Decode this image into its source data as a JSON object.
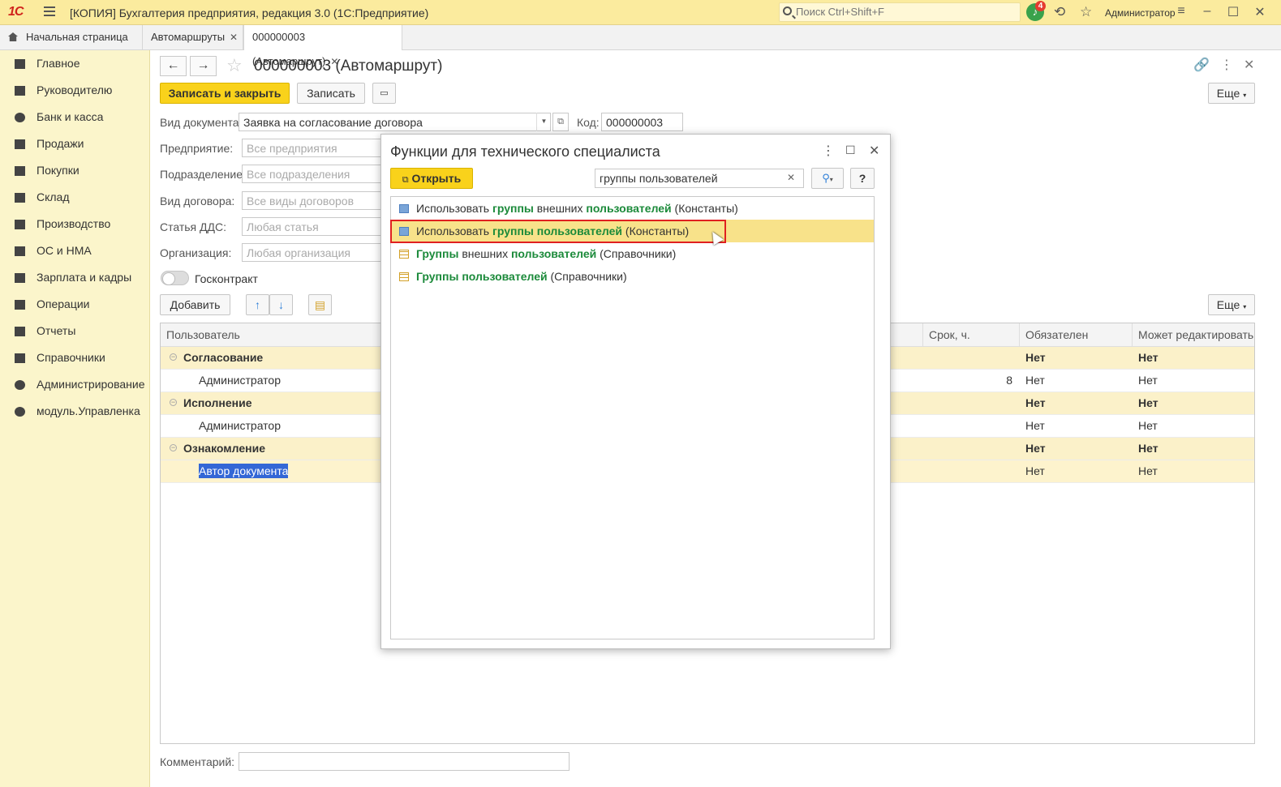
{
  "titlebar": {
    "logo": "1С",
    "title": "[КОПИЯ] Бухгалтерия предприятия, редакция 3.0  (1С:Предприятие)",
    "search_placeholder": "Поиск Ctrl+Shift+F",
    "notifications_count": "4",
    "user": "Администратор"
  },
  "tabs": [
    {
      "label": "Начальная страница"
    },
    {
      "label": "Автомаршруты"
    },
    {
      "label": "000000003 (Автомаршрут)"
    }
  ],
  "sidebar": {
    "items": [
      {
        "label": "Главное"
      },
      {
        "label": "Руководителю"
      },
      {
        "label": "Банк и касса"
      },
      {
        "label": "Продажи"
      },
      {
        "label": "Покупки"
      },
      {
        "label": "Склад"
      },
      {
        "label": "Производство"
      },
      {
        "label": "ОС и НМА"
      },
      {
        "label": "Зарплата и кадры"
      },
      {
        "label": "Операции"
      },
      {
        "label": "Отчеты"
      },
      {
        "label": "Справочники"
      },
      {
        "label": "Администрирование"
      },
      {
        "label": "модуль.Управленка"
      }
    ]
  },
  "form": {
    "title": "000000003 (Автомаршрут)",
    "save_close": "Записать и закрыть",
    "save": "Записать",
    "more": "Еще",
    "doc_type_label": "Вид документа:",
    "doc_type_value": "Заявка на согласование договора",
    "code_label": "Код:",
    "code_value": "000000003",
    "enterprise_label": "Предприятие:",
    "enterprise_ph": "Все предприятия",
    "division_label": "Подразделение:",
    "division_ph": "Все подразделения",
    "contract_type_label": "Вид договора:",
    "contract_type_ph": "Все виды договоров",
    "dds_label": "Статья ДДС:",
    "dds_ph": "Любая статья",
    "org_label": "Организация:",
    "org_ph": "Любая организация",
    "goscontract_label": "Госконтракт",
    "add": "Добавить",
    "more2": "Еще",
    "comment_label": "Комментарий:"
  },
  "grid": {
    "headers": [
      "Пользователь",
      "Срок, ч.",
      "Обязателен",
      "Может редактировать"
    ],
    "rows": [
      {
        "user": "Согласование",
        "term": "",
        "required": "Нет",
        "editable": "Нет",
        "group": true
      },
      {
        "user": "Администратор",
        "term": "8",
        "required": "Нет",
        "editable": "Нет",
        "group": false
      },
      {
        "user": "Исполнение",
        "term": "",
        "required": "Нет",
        "editable": "Нет",
        "group": true
      },
      {
        "user": "Администратор",
        "term": "",
        "required": "Нет",
        "editable": "Нет",
        "group": false
      },
      {
        "user": "Ознакомление",
        "term": "",
        "required": "Нет",
        "editable": "Нет",
        "group": true
      },
      {
        "user": "Автор документа",
        "term": "",
        "required": "Нет",
        "editable": "Нет",
        "group": false
      }
    ]
  },
  "dialog": {
    "title": "Функции для технического специалиста",
    "open": "Открыть",
    "search_value": "группы пользователей",
    "help": "?",
    "items": [
      {
        "parts": [
          [
            "Использовать ",
            false
          ],
          [
            "группы",
            true
          ],
          [
            " внешних ",
            false
          ],
          [
            "пользователей",
            true
          ],
          [
            " (Константы)",
            false
          ]
        ]
      },
      {
        "parts": [
          [
            "Использовать ",
            false
          ],
          [
            "группы пользователей",
            true
          ],
          [
            " (Константы)",
            false
          ]
        ]
      },
      {
        "parts": [
          [
            "Группы",
            true
          ],
          [
            " внешних ",
            false
          ],
          [
            "пользователей",
            true
          ],
          [
            " (Справочники)",
            false
          ]
        ]
      },
      {
        "parts": [
          [
            "Группы пользователей",
            true
          ],
          [
            " (Справочники)",
            false
          ]
        ]
      }
    ]
  }
}
